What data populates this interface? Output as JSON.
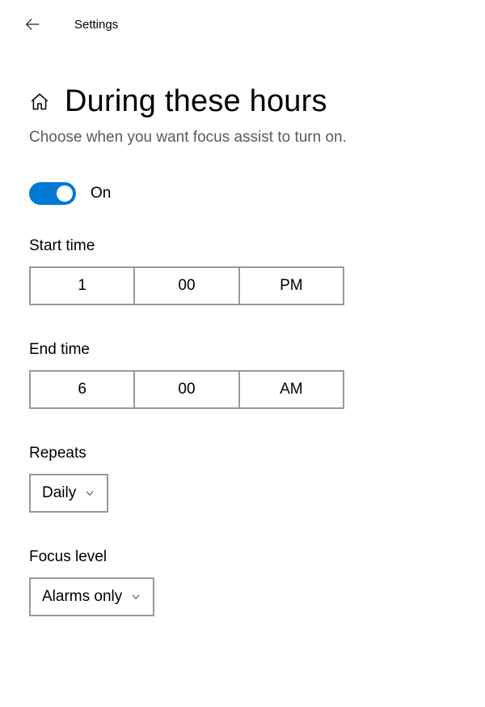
{
  "header": {
    "title": "Settings"
  },
  "page": {
    "title": "During these hours",
    "description": "Choose when you want focus assist to turn on."
  },
  "toggle": {
    "state_label": "On"
  },
  "start_time": {
    "label": "Start time",
    "hour": "1",
    "minute": "00",
    "ampm": "PM"
  },
  "end_time": {
    "label": "End time",
    "hour": "6",
    "minute": "00",
    "ampm": "AM"
  },
  "repeats": {
    "label": "Repeats",
    "value": "Daily"
  },
  "focus_level": {
    "label": "Focus level",
    "value": "Alarms only"
  }
}
